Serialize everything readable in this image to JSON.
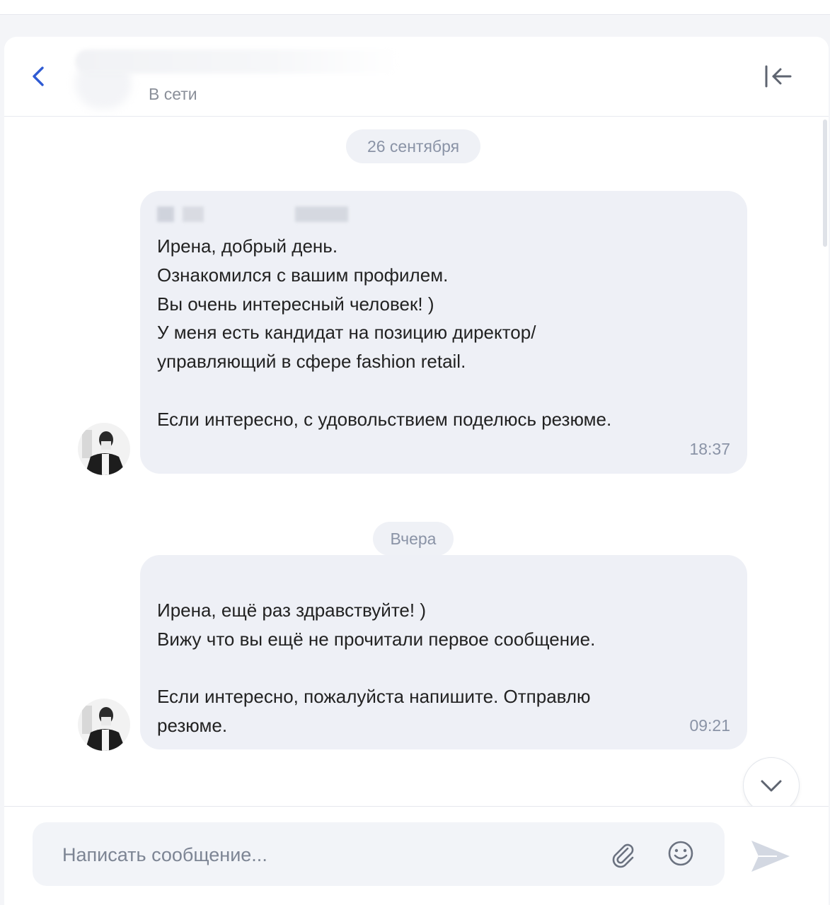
{
  "header": {
    "status": "В сети"
  },
  "dates": {
    "first": "26 сентября",
    "second": "Вчера"
  },
  "messages": [
    {
      "text": "Ирена, добрый день.\nОзнакомился с вашим профилем.\nВы очень интересный человек! )\nУ меня есть кандидат на позицию директор/\nуправляющий в сфере fashion retail.\n\nЕсли интересно, с удовольствием поделюсь резюме.",
      "time": "18:37"
    },
    {
      "text": "Ирена, ещё раз здравствуйте! )\nВижу что вы ещё не прочитали первое сообщение.\n\nЕсли интересно, пожалуйста напишите. Отправлю\nрезюме.",
      "time": "09:21"
    }
  ],
  "composer": {
    "placeholder": "Написать сообщение..."
  },
  "icons": {
    "back": "chevron-left-icon",
    "collapse": "collapse-panel-icon",
    "scroll": "chevron-down-icon",
    "attach": "paperclip-icon",
    "emoji": "smiley-icon",
    "send": "send-icon"
  },
  "colors": {
    "accent": "#2f5bd3",
    "bubble": "#eef0f6",
    "muted": "#8a93a6"
  }
}
